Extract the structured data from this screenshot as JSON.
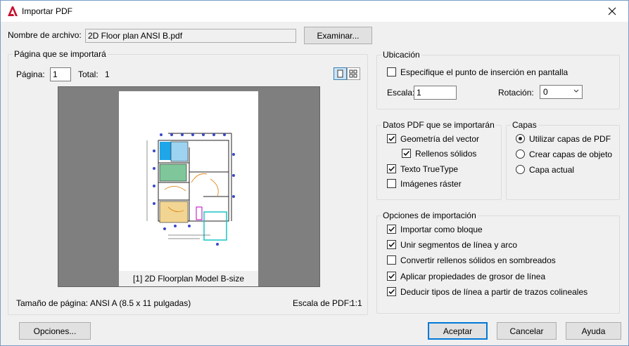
{
  "window": {
    "title": "Importar PDF"
  },
  "file": {
    "label": "Nombre de archivo:",
    "value": "2D Floor plan ANSI B.pdf",
    "browse": "Examinar..."
  },
  "pages": {
    "legend": "Página que se importará",
    "page_label": "Página:",
    "page_value": "1",
    "total_label": "Total:",
    "total_value": "1",
    "caption": "[1] 2D Floorplan Model B-size",
    "size_label": "Tamaño de página:",
    "size_value": "ANSI A (8.5 x 11 pulgadas)",
    "scale_label": "Escala de PDF:",
    "scale_value": "1:1"
  },
  "location": {
    "legend": "Ubicación",
    "specify_label": "Especifique el punto de inserción en pantalla",
    "specify_checked": false,
    "scale_label": "Escala:",
    "scale_value": "1",
    "rotation_label": "Rotación:",
    "rotation_value": "0"
  },
  "pdf_data": {
    "legend": "Datos PDF que se importarán",
    "items": [
      {
        "label": "Geometría del vector",
        "checked": true
      },
      {
        "label": "Rellenos sólidos",
        "checked": true
      },
      {
        "label": "Texto TrueType",
        "checked": true
      },
      {
        "label": "Imágenes ráster",
        "checked": false
      }
    ]
  },
  "layers": {
    "legend": "Capas",
    "options": [
      {
        "label": "Utilizar capas de PDF",
        "selected": true
      },
      {
        "label": "Crear capas de objeto",
        "selected": false
      },
      {
        "label": "Capa actual",
        "selected": false
      }
    ]
  },
  "import_options": {
    "legend": "Opciones de importación",
    "items": [
      {
        "label": "Importar como bloque",
        "checked": true
      },
      {
        "label": "Unir segmentos de línea y arco",
        "checked": true
      },
      {
        "label": "Convertir rellenos sólidos en sombreados",
        "checked": false
      },
      {
        "label": "Aplicar propiedades de grosor de línea",
        "checked": true
      },
      {
        "label": "Deducir tipos de línea a partir de trazos colineales",
        "checked": true
      }
    ]
  },
  "footer": {
    "options": "Opciones...",
    "ok": "Aceptar",
    "cancel": "Cancelar",
    "help": "Ayuda"
  },
  "colors": {
    "accent": "#0078d7",
    "app_icon": "#c8102e",
    "preview_bg": "#7f7f7f"
  }
}
